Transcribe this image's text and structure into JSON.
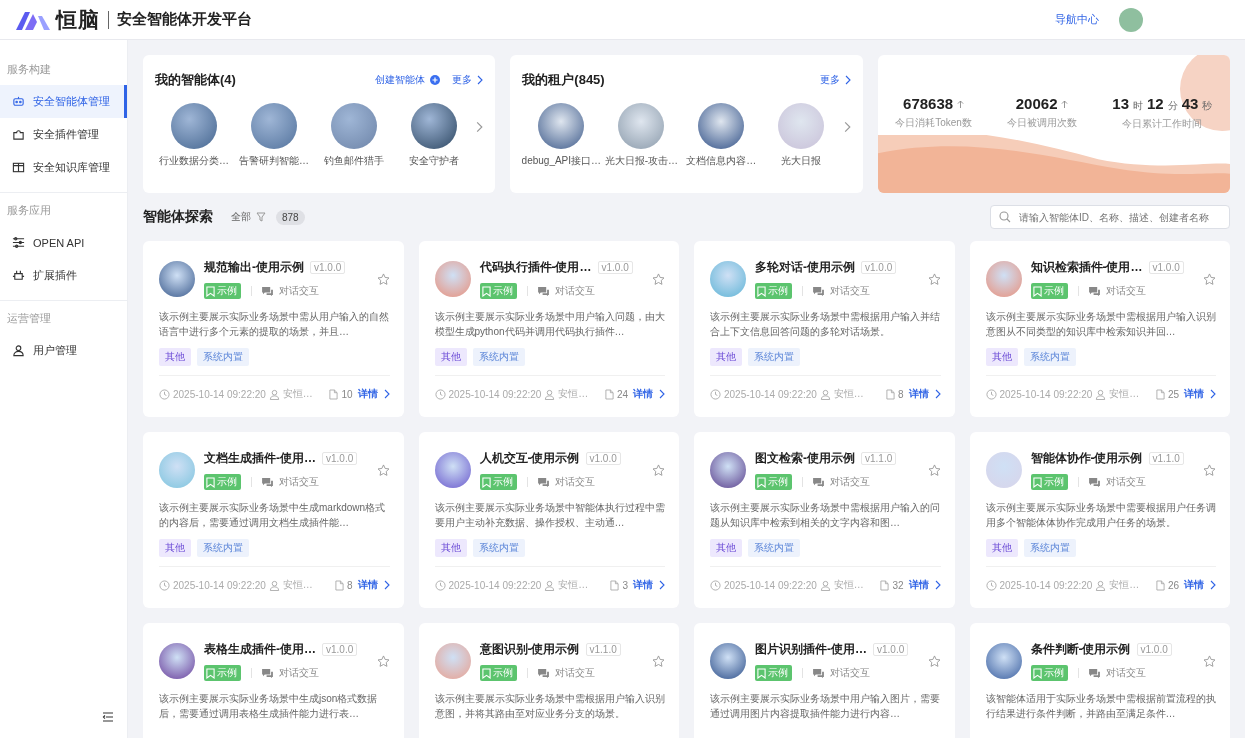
{
  "header": {
    "brand": "恒脑",
    "title": "安全智能体开发平台",
    "nav_link": "导航中心"
  },
  "sidebar": {
    "groups": [
      {
        "label": "服务构建",
        "items": [
          {
            "label": "安全智能体管理",
            "selected": true
          },
          {
            "label": "安全插件管理",
            "selected": false
          },
          {
            "label": "安全知识库管理",
            "selected": false
          }
        ]
      },
      {
        "label": "服务应用",
        "items": [
          {
            "label": "OPEN API",
            "selected": false
          },
          {
            "label": "扩展插件",
            "selected": false
          }
        ]
      },
      {
        "label": "运营管理",
        "items": [
          {
            "label": "用户管理",
            "selected": false
          }
        ]
      }
    ]
  },
  "my_agents": {
    "title": "我的智能体(4)",
    "create": "创建智能体",
    "more": "更多",
    "items": [
      {
        "name": "行业数据分类…"
      },
      {
        "name": "告警研判智能…"
      },
      {
        "name": "钓鱼邮件猎手"
      },
      {
        "name": "安全守护者"
      }
    ]
  },
  "my_tenants": {
    "title": "我的租户(845)",
    "more": "更多",
    "items": [
      {
        "name": "debug_API接口…"
      },
      {
        "name": "光大日报-攻击…"
      },
      {
        "name": "文档信息内容…"
      },
      {
        "name": "光大日报"
      }
    ]
  },
  "stats": [
    {
      "kind": "number",
      "value": "678638",
      "label": "今日消耗Token数"
    },
    {
      "kind": "number",
      "value": "20062",
      "label": "今日被调用次数"
    },
    {
      "kind": "duration",
      "parts": [
        {
          "value": "13",
          "unit": "时"
        },
        {
          "value": "12",
          "unit": "分"
        },
        {
          "value": "43",
          "unit": "秒"
        }
      ],
      "label": "今日累计工作时间"
    }
  ],
  "explore": {
    "title": "智能体探索",
    "filter": "全部",
    "count": "878",
    "search": {
      "placeholder": "请输入智能体ID、名称、描述、创建者名称"
    }
  },
  "agents": [
    {
      "title": "规范输出-使用示例",
      "version": "v1.0.0",
      "badge": "示例",
      "mode": "对话交互",
      "starred": false,
      "description": "该示例主要展示实际业务场景中需从用户输入的自然语言中进行多个元素的提取的场景，并且…",
      "tags": [
        "其他",
        "系统内置"
      ],
      "date": "2025-10-14 09:22:20",
      "author": "安恒…",
      "count": "10",
      "action": "详情"
    },
    {
      "title": "代码执行插件-使用…",
      "version": "v1.0.0",
      "badge": "示例",
      "mode": "对话交互",
      "starred": false,
      "description": "该示例主要展示实际业务场景中用户输入问题，由大模型生成python代码并调用代码执行插件…",
      "tags": [
        "其他",
        "系统内置"
      ],
      "date": "2025-10-14 09:22:20",
      "author": "安恒…",
      "count": "24",
      "action": "详情"
    },
    {
      "title": "多轮对话-使用示例",
      "version": "v1.0.0",
      "badge": "示例",
      "mode": "对话交互",
      "starred": false,
      "description": "该示例主要展示实际业务场景中需根据用户输入并结合上下文信息回答问题的多轮对话场景。",
      "tags": [
        "其他",
        "系统内置"
      ],
      "date": "2025-10-14 09:22:20",
      "author": "安恒…",
      "count": "8",
      "action": "详情"
    },
    {
      "title": "知识检索插件-使用…",
      "version": "v1.0.0",
      "badge": "示例",
      "mode": "对话交互",
      "starred": false,
      "description": "该示例主要展示实际业务场景中需根据用户输入识别意图从不同类型的知识库中检索知识并回…",
      "tags": [
        "其他",
        "系统内置"
      ],
      "date": "2025-10-14 09:22:20",
      "author": "安恒…",
      "count": "25",
      "action": "详情"
    },
    {
      "title": "文档生成插件-使用…",
      "version": "v1.0.0",
      "badge": "示例",
      "mode": "对话交互",
      "starred": false,
      "description": "该示例主要展示实际业务场景中生成markdown格式的内容后，需要通过调用文档生成插件能…",
      "tags": [
        "其他",
        "系统内置"
      ],
      "date": "2025-10-14 09:22:20",
      "author": "安恒…",
      "count": "8",
      "action": "详情"
    },
    {
      "title": "人机交互-使用示例",
      "version": "v1.0.0",
      "badge": "示例",
      "mode": "对话交互",
      "starred": false,
      "description": "该示例主要展示实际业务场景中智能体执行过程中需要用户主动补充数据、操作授权、主动通…",
      "tags": [
        "其他",
        "系统内置"
      ],
      "date": "2025-10-14 09:22:20",
      "author": "安恒…",
      "count": "3",
      "action": "详情"
    },
    {
      "title": "图文检索-使用示例",
      "version": "v1.1.0",
      "badge": "示例",
      "mode": "对话交互",
      "starred": false,
      "description": "该示例主要展示实际业务场景中需根据用户输入的问题从知识库中检索到相关的文字内容和图…",
      "tags": [
        "其他",
        "系统内置"
      ],
      "date": "2025-10-14 09:22:20",
      "author": "安恒…",
      "count": "32",
      "action": "详情"
    },
    {
      "title": "智能体协作-使用示例",
      "version": "v1.1.0",
      "badge": "示例",
      "mode": "对话交互",
      "starred": false,
      "description": "该示例主要展示实际业务场景中需要根据用户任务调用多个智能体体协作完成用户任务的场景。",
      "tags": [
        "其他",
        "系统内置"
      ],
      "date": "2025-10-14 09:22:20",
      "author": "安恒…",
      "count": "26",
      "action": "详情"
    },
    {
      "title": "表格生成插件-使用…",
      "version": "v1.0.0",
      "badge": "示例",
      "mode": "对话交互",
      "starred": false,
      "description": "该示例主要展示实际业务场景中生成json格式数据后，需要通过调用表格生成插件能力进行表…"
    },
    {
      "title": "意图识别-使用示例",
      "version": "v1.1.0",
      "badge": "示例",
      "mode": "对话交互",
      "starred": false,
      "description": "该示例主要展示实际业务场景中需根据用户输入识别意图，并将其路由至对应业务分支的场景。"
    },
    {
      "title": "图片识别插件-使用…",
      "version": "v1.0.0",
      "badge": "示例",
      "mode": "对话交互",
      "starred": false,
      "description": "该示例主要展示实际业务场景中用户输入图片，需要通过调用图片内容提取插件能力进行内容…"
    },
    {
      "title": "条件判断-使用示例",
      "version": "v1.0.0",
      "badge": "示例",
      "mode": "对话交互",
      "starred": false,
      "description": "该智能体适用于实际业务场景中需根据前置流程的执行结果进行条件判断，并路由至满足条件…"
    }
  ]
}
